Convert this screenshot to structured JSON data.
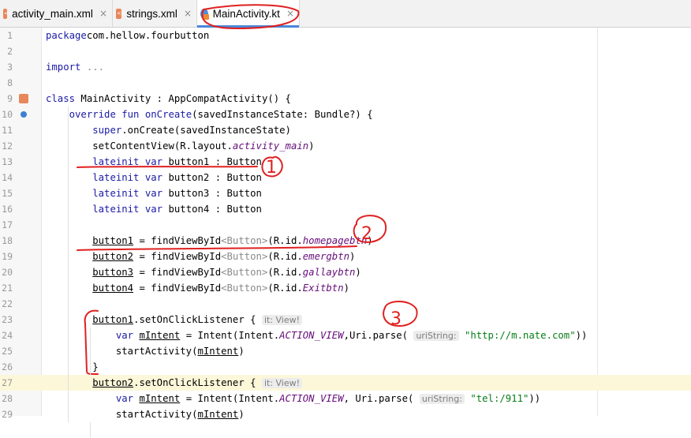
{
  "tabs": [
    {
      "label": "activity_main.xml",
      "icon": "xml-file-icon",
      "active": false
    },
    {
      "label": "strings.xml",
      "icon": "xml-file-icon",
      "active": false
    },
    {
      "label": "MainActivity.kt",
      "icon": "kotlin-file-icon",
      "active": true
    }
  ],
  "close_glyph": "×",
  "lines": [
    {
      "n": "1",
      "tokens": [
        [
          "kw",
          "package"
        ],
        [
          "",
          "com.hellow.fourbutton"
        ]
      ]
    },
    {
      "n": "2",
      "tokens": []
    },
    {
      "n": "3",
      "tokens": [
        [
          "kw",
          "import"
        ],
        [
          "",
          " "
        ],
        [
          "gray",
          "..."
        ]
      ]
    },
    {
      "n": "8",
      "tokens": []
    },
    {
      "n": "9",
      "tokens": [
        [
          "kw",
          "class"
        ],
        [
          "",
          " MainActivity : AppCompatActivity() {"
        ]
      ]
    },
    {
      "n": "10",
      "tokens": [
        [
          "",
          "    "
        ],
        [
          "kw",
          "override fun"
        ],
        [
          "",
          " "
        ],
        [
          "kwfn",
          "onCreate"
        ],
        [
          "",
          "(savedInstanceState: Bundle?) {"
        ]
      ]
    },
    {
      "n": "11",
      "tokens": [
        [
          "",
          "        "
        ],
        [
          "kw",
          "super"
        ],
        [
          "",
          ".onCreate(savedInstanceState)"
        ]
      ]
    },
    {
      "n": "12",
      "tokens": [
        [
          "",
          "        setContentView(R.layout."
        ],
        [
          "ital",
          "activity_main"
        ],
        [
          "",
          ")"
        ]
      ]
    },
    {
      "n": "13",
      "tokens": [
        [
          "",
          "        "
        ],
        [
          "kw",
          "lateinit var"
        ],
        [
          "",
          " button1 : Button"
        ]
      ]
    },
    {
      "n": "14",
      "tokens": [
        [
          "",
          "        "
        ],
        [
          "kw",
          "lateinit var"
        ],
        [
          "",
          " button2 : Button"
        ]
      ]
    },
    {
      "n": "15",
      "tokens": [
        [
          "",
          "        "
        ],
        [
          "kw",
          "lateinit var"
        ],
        [
          "",
          " button3 : Button"
        ]
      ]
    },
    {
      "n": "16",
      "tokens": [
        [
          "",
          "        "
        ],
        [
          "kw",
          "lateinit var"
        ],
        [
          "",
          " button4 : Button"
        ]
      ]
    },
    {
      "n": "17",
      "tokens": []
    },
    {
      "n": "18",
      "tokens": [
        [
          "",
          "        "
        ],
        [
          "ul",
          "button1"
        ],
        [
          "",
          " = findViewById"
        ],
        [
          "gray",
          "<Button>"
        ],
        [
          "",
          "(R.id."
        ],
        [
          "ital",
          "homepagebtn"
        ],
        [
          "",
          ")"
        ]
      ]
    },
    {
      "n": "19",
      "tokens": [
        [
          "",
          "        "
        ],
        [
          "ul",
          "button2"
        ],
        [
          "",
          " = findViewById"
        ],
        [
          "gray",
          "<Button>"
        ],
        [
          "",
          "(R.id."
        ],
        [
          "ital",
          "emergbtn"
        ],
        [
          "",
          ")"
        ]
      ]
    },
    {
      "n": "20",
      "tokens": [
        [
          "",
          "        "
        ],
        [
          "ul",
          "button3"
        ],
        [
          "",
          " = findViewById"
        ],
        [
          "gray",
          "<Button>"
        ],
        [
          "",
          "(R.id."
        ],
        [
          "ital",
          "gallaybtn"
        ],
        [
          "",
          ")"
        ]
      ]
    },
    {
      "n": "21",
      "tokens": [
        [
          "",
          "        "
        ],
        [
          "ul",
          "button4"
        ],
        [
          "",
          " = findViewById"
        ],
        [
          "gray",
          "<Button>"
        ],
        [
          "",
          "(R.id."
        ],
        [
          "ital",
          "Exitbtn"
        ],
        [
          "",
          ")"
        ]
      ]
    },
    {
      "n": "22",
      "tokens": []
    },
    {
      "n": "23",
      "tokens": [
        [
          "",
          "        "
        ],
        [
          "ul",
          "button1"
        ],
        [
          "",
          ".setOnClickListener { "
        ],
        [
          "hint",
          "it: View!"
        ]
      ]
    },
    {
      "n": "24",
      "tokens": [
        [
          "",
          "            "
        ],
        [
          "kw",
          "var"
        ],
        [
          "",
          " "
        ],
        [
          "ul",
          "mIntent"
        ],
        [
          "",
          " = Intent(Intent."
        ],
        [
          "ital",
          "ACTION_VIEW"
        ],
        [
          "",
          ",Uri.parse( "
        ],
        [
          "hint",
          "uriString:"
        ],
        [
          "",
          " "
        ],
        [
          "str",
          "\"http://m.nate.com\""
        ],
        [
          "",
          "))"
        ]
      ]
    },
    {
      "n": "25",
      "tokens": [
        [
          "",
          "            startActivity("
        ],
        [
          "ul",
          "mIntent"
        ],
        [
          "",
          ")"
        ]
      ]
    },
    {
      "n": "26",
      "tokens": [
        [
          "",
          "        }"
        ]
      ]
    },
    {
      "n": "27",
      "tokens": [
        [
          "",
          "        "
        ],
        [
          "ul",
          "button2"
        ],
        [
          "",
          ".setOnClickListener { "
        ],
        [
          "hint",
          "it: View!"
        ]
      ],
      "highlight": true
    },
    {
      "n": "28",
      "tokens": [
        [
          "",
          "            "
        ],
        [
          "kw",
          "var"
        ],
        [
          "",
          " "
        ],
        [
          "ul",
          "mIntent"
        ],
        [
          "",
          " = Intent(Intent."
        ],
        [
          "ital",
          "ACTION_VIEW"
        ],
        [
          "",
          ", Uri.parse( "
        ],
        [
          "hint",
          "uriString:"
        ],
        [
          "",
          " "
        ],
        [
          "str",
          "\"tel:/911\""
        ],
        [
          "",
          "))"
        ]
      ]
    },
    {
      "n": "29",
      "tokens": [
        [
          "",
          "            startActivity("
        ],
        [
          "ul",
          "mIntent"
        ],
        [
          "",
          ")"
        ]
      ]
    }
  ],
  "gutter_icons": [
    {
      "line": "9",
      "icon": "xml-layout-icon"
    },
    {
      "line": "10",
      "icon": "override-icon"
    }
  ],
  "annotations": {
    "color": "#e02020",
    "marks": [
      "1",
      "2",
      "3"
    ]
  }
}
